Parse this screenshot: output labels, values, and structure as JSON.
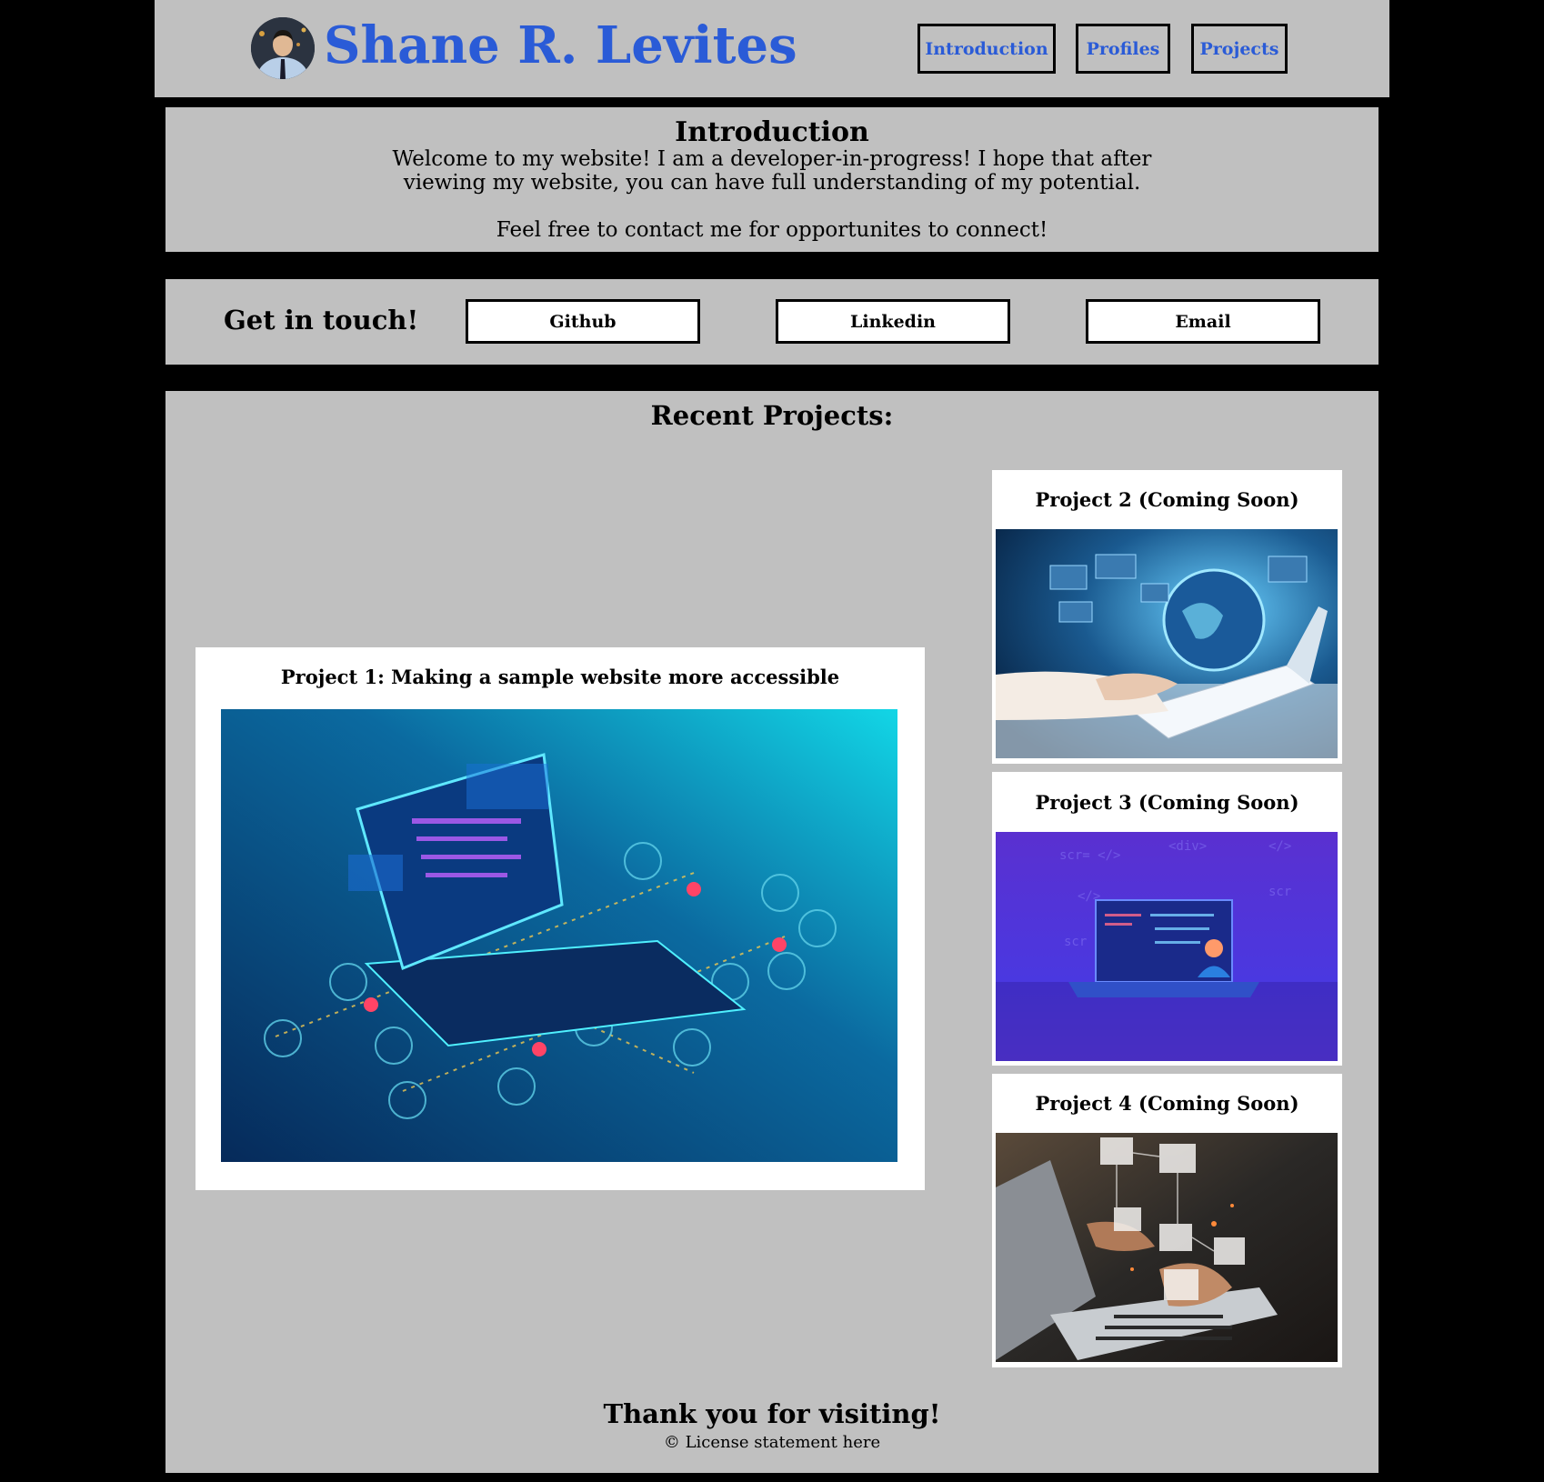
{
  "header": {
    "title": "Shane R. Levites",
    "nav": [
      "Introduction",
      "Profiles",
      "Projects"
    ]
  },
  "intro": {
    "title": "Introduction",
    "line1": "Welcome to my website! I am a developer-in-progress! I hope that after",
    "line2": "viewing my website, you can have full understanding of my potential.",
    "line3": "Feel free to contact me for opportunites to connect!"
  },
  "contact": {
    "title": "Get in touch!",
    "buttons": [
      "Github",
      "Linkedin",
      "Email"
    ]
  },
  "projects": {
    "title": "Recent Projects:",
    "items": [
      {
        "title": "Project 1: Making a sample website more accessible"
      },
      {
        "title": "Project 2 (Coming Soon)"
      },
      {
        "title": "Project 3 (Coming Soon)"
      },
      {
        "title": "Project 4 (Coming Soon)"
      }
    ]
  },
  "footer": {
    "thanks": "Thank you for visiting!",
    "license": "© License statement here"
  },
  "colors": {
    "panel": "#c0c0c0",
    "accent_blue": "#2a5bd7",
    "page_background": "#000000"
  }
}
